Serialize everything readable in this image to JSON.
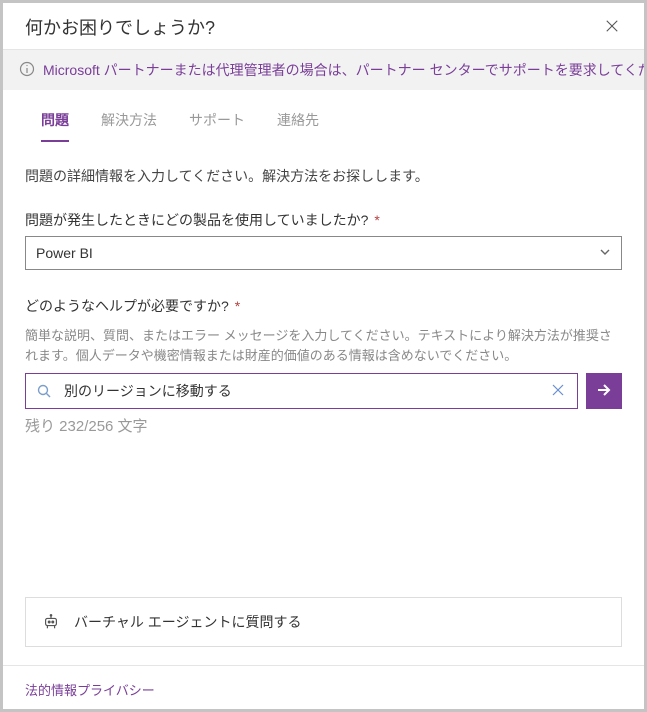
{
  "header": {
    "title": "何かお困りでしょうか?"
  },
  "banner": {
    "link_text": "Microsoft パートナーまたは代理管理者の場合は、パートナー センターでサポートを要求してくだ"
  },
  "tabs": {
    "items": [
      {
        "label": "問題",
        "active": true
      },
      {
        "label": "解決方法"
      },
      {
        "label": "サポート"
      },
      {
        "label": "連絡先"
      }
    ]
  },
  "intro_text": "問題の詳細情報を入力してください。解決方法をお探しします。",
  "product_field": {
    "label": "問題が発生したときにどの製品を使用していましたか?",
    "value": "Power BI"
  },
  "help_field": {
    "label": "どのようなヘルプが必要ですか?",
    "hint": "簡単な説明、質問、またはエラー メッセージを入力してください。テキストにより解決方法が推奨されます。個人データや機密情報または財産的価値のある情報は含めないでください。",
    "value": "別のリージョンに移動する"
  },
  "counter_text": "残り 232/256 文字",
  "virtual_agent_text": "バーチャル エージェントに質問する",
  "footer": {
    "legal": "法的情報",
    "privacy": "プライバシー"
  }
}
